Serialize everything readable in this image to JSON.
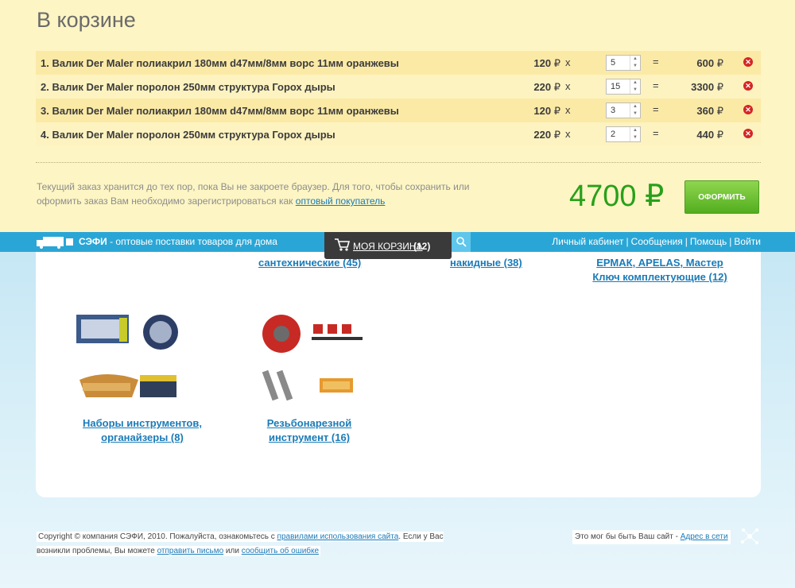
{
  "cart": {
    "title": "В корзине",
    "currency": "₽",
    "items": [
      {
        "num": "1.",
        "name": "Валик Der Maler полиакрил 180мм d47мм/8мм ворс 11мм оранжевы",
        "price": "120",
        "x": "x",
        "qty": "5",
        "eq": "=",
        "sum": "600"
      },
      {
        "num": "2.",
        "name": "Валик Der Maler поролон 250мм структура Горох дыры",
        "price": "220",
        "x": "x",
        "qty": "15",
        "eq": "=",
        "sum": "3300"
      },
      {
        "num": "3.",
        "name": "Валик Der Maler полиакрил 180мм d47мм/8мм ворс 11мм оранжевы",
        "price": "120",
        "x": "x",
        "qty": "3",
        "eq": "=",
        "sum": "360"
      },
      {
        "num": "4.",
        "name": "Валик Der Maler поролон 250мм структура Горох дыры",
        "price": "220",
        "x": "x",
        "qty": "2",
        "eq": "=",
        "sum": "440"
      }
    ],
    "note_text": "Текущий заказ хранится до тех пор, пока Вы не закроете браузер. Для того, чтобы сохранить или оформить заказ Вам необходимо зарегистрироваться как",
    "note_link": "оптовый покупатель",
    "total": "4700 ₽",
    "checkout_label": "ОФОРМИТЬ"
  },
  "topbar": {
    "brand_name": "СЭФИ",
    "brand_tagline": " - оптовые поставки товаров для дома",
    "cart_label": "МОЯ КОРЗИНА",
    "cart_count": "(12)",
    "links": [
      "Личный кабинет",
      "Сообщения",
      "Помощь",
      "Войти"
    ]
  },
  "catalog": {
    "partial": [
      {
        "line2": "сантехнические (45)"
      },
      {
        "line2": "накидные (38)"
      },
      {
        "line1": "ЕРМАК, APELAS, Мастер",
        "line2": "Ключ комплектующие (12)"
      }
    ],
    "categories": [
      {
        "line1": "Наборы инструментов,",
        "line2": "органайзеры (8)"
      },
      {
        "line1": "Резьбонарезной",
        "line2": "инструмент (16)"
      }
    ]
  },
  "footer": {
    "copyright_pre": "Copyright © компания СЭФИ, 2010. Пожалуйста, ознакомьтесь с ",
    "rules_link": "правилами использования сайта",
    "copyright_mid": ". Если у Вас возникли проблемы, Вы можете ",
    "send_link": "отправить письмо",
    "or_text": " или ",
    "report_link": "сообщить об ошибке",
    "right_text": "Это мог бы быть Ваш сайт - ",
    "right_link": "Адрес в сети"
  },
  "colors": {
    "accent_blue": "#2aa6d6",
    "total_green": "#28a01a",
    "cart_bg": "#fdf5c4"
  }
}
